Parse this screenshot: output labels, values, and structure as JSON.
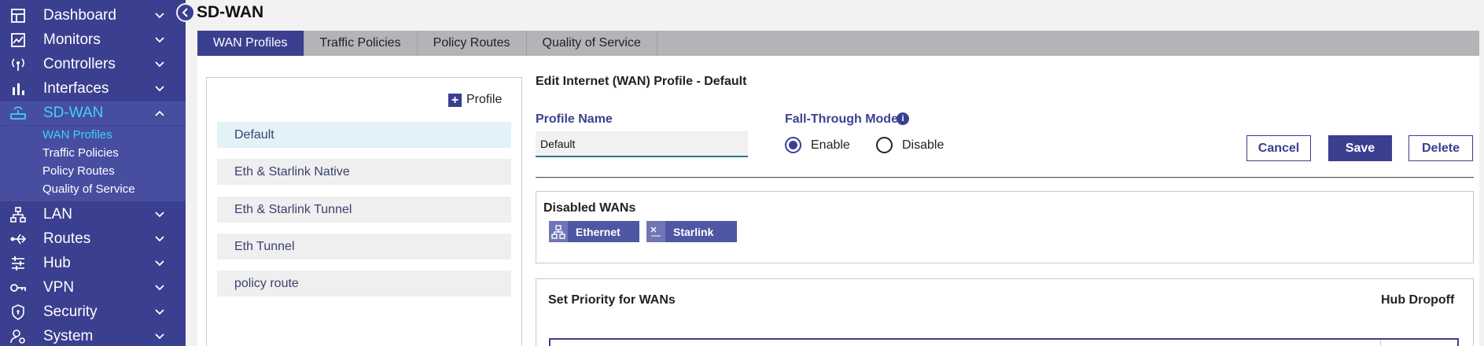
{
  "sidebar": {
    "items": [
      {
        "label": "Dashboard",
        "icon": "dashboard-icon"
      },
      {
        "label": "Monitors",
        "icon": "monitors-icon"
      },
      {
        "label": "Controllers",
        "icon": "controllers-icon"
      },
      {
        "label": "Interfaces",
        "icon": "interfaces-icon"
      },
      {
        "label": "SD-WAN",
        "icon": "sdwan-icon"
      },
      {
        "label": "LAN",
        "icon": "lan-icon"
      },
      {
        "label": "Routes",
        "icon": "routes-icon"
      },
      {
        "label": "Hub",
        "icon": "hub-icon"
      },
      {
        "label": "VPN",
        "icon": "vpn-icon"
      },
      {
        "label": "Security",
        "icon": "security-icon"
      },
      {
        "label": "System",
        "icon": "system-icon"
      }
    ],
    "active_item": "SD-WAN",
    "sub_items": [
      "WAN Profiles",
      "Traffic Policies",
      "Policy Routes",
      "Quality of Service"
    ],
    "active_sub_item": "WAN Profiles"
  },
  "page": {
    "title": "SD-WAN"
  },
  "tabs": [
    "WAN Profiles",
    "Traffic Policies",
    "Policy Routes",
    "Quality of Service"
  ],
  "active_tab": "WAN Profiles",
  "profiles": {
    "add_label": "Profile",
    "items": [
      "Default",
      "Eth & Starlink Native",
      "Eth & Starlink Tunnel",
      "Eth Tunnel",
      "policy route"
    ],
    "selected": "Default"
  },
  "editor": {
    "title": "Edit Internet (WAN) Profile - Default",
    "profile_name_label": "Profile Name",
    "profile_name_value": "Default",
    "fall_through_label": "Fall-Through Mode",
    "fall_through_options": [
      "Enable",
      "Disable"
    ],
    "fall_through_selected": "Enable",
    "cancel_label": "Cancel",
    "save_label": "Save",
    "delete_label": "Delete"
  },
  "disabled_wans": {
    "title": "Disabled WANs",
    "items": [
      {
        "label": "Ethernet",
        "icon": "network-icon"
      },
      {
        "label": "Starlink",
        "icon": "satellite-icon"
      }
    ]
  },
  "priority": {
    "title": "Set Priority for WANs",
    "hub_dropoff_label": "Hub Dropoff"
  },
  "colors": {
    "sidebar_bg": "#3a3f8f",
    "accent": "#3fd3f0",
    "primary": "#3a3f8f"
  }
}
